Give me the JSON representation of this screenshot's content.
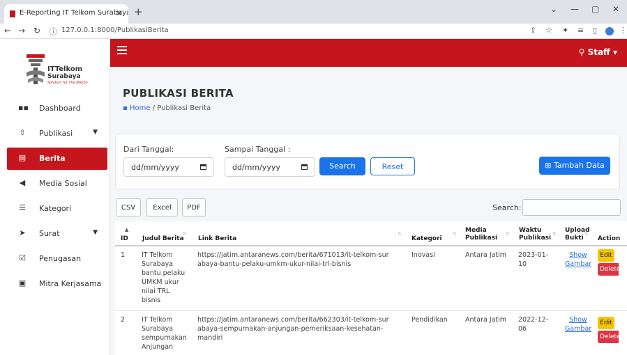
{
  "browser": {
    "tab_title": "E-Reporting IT Telkom Surabaya",
    "url": "127.0.0.1:8000/PublikasiBerita"
  },
  "header": {
    "user_menu": "Staff"
  },
  "logo": {
    "line1": "ITTelkom",
    "line2": "Surabaya",
    "tagline": "Solution for The Nation"
  },
  "sidebar": {
    "items": [
      {
        "label": "Dashboard",
        "icon": "grid-icon"
      },
      {
        "label": "Publikasi",
        "icon": "upload-icon"
      },
      {
        "label": "Berita",
        "icon": "newspaper-icon",
        "active": true
      },
      {
        "label": "Media Sosial",
        "icon": "megaphone-icon"
      },
      {
        "label": "Kategori",
        "icon": "list-icon"
      },
      {
        "label": "Surat",
        "icon": "send-icon"
      },
      {
        "label": "Penugasan",
        "icon": "checkbox-icon"
      },
      {
        "label": "Mitra Kerjasama",
        "icon": "id-card-icon"
      }
    ]
  },
  "page": {
    "title": "PUBLIKASI BERITA",
    "breadcrumb_home": "Home",
    "breadcrumb_current": "/ Publikasi Berita"
  },
  "filter": {
    "from_label": "Dari Tanggal:",
    "to_label": "Sampai Tanggal :",
    "from_value": "dd/mm/yyyy",
    "to_value": "dd/mm/yyyy",
    "search_button": "Search",
    "reset_button": "Reset",
    "add_button": "Tambah Data"
  },
  "toolbar": {
    "csv": "CSV",
    "excel": "Excel",
    "pdf": "PDF",
    "search_label": "Search:"
  },
  "table": {
    "columns": [
      "ID",
      "Judul Berita",
      "Link Berita",
      "Kategori",
      "Media Publikasi",
      "Waktu Publikasi",
      "Upload Bukti",
      "Action"
    ],
    "rows": [
      {
        "id": "1",
        "judul": "IT Telkom Surabaya bantu pelaku UMKM ukur nilai TRL bisnis",
        "link": "https://jatim.antaranews.com/berita/671013/it-telkom-surabaya-bantu-pelaku-umkm-ukur-nilai-trl-bisnis",
        "kategori": "Inovasi",
        "media": "Antara Jatim",
        "waktu": "2023-01-10",
        "bukti": "Show Gambar",
        "edit": "Edit",
        "delete": "Delete"
      },
      {
        "id": "2",
        "judul": "IT Telkom Surabaya sempurnakan Anjungan",
        "link": "https://jatim.antaranews.com/berita/662303/it-telkom-surabaya-sempurnakan-anjungan-pemeriksaan-kesehatan-mandiri",
        "kategori": "Pendidikan",
        "media": "Antara Jatim",
        "waktu": "2022-12-06",
        "bukti": "Show Gambar",
        "edit": "Edit",
        "delete": "Delete"
      }
    ]
  },
  "colors": {
    "brand": "#c4161c",
    "primary": "#1a73e8",
    "edit": "#f5c400",
    "delete": "#dc3545"
  }
}
